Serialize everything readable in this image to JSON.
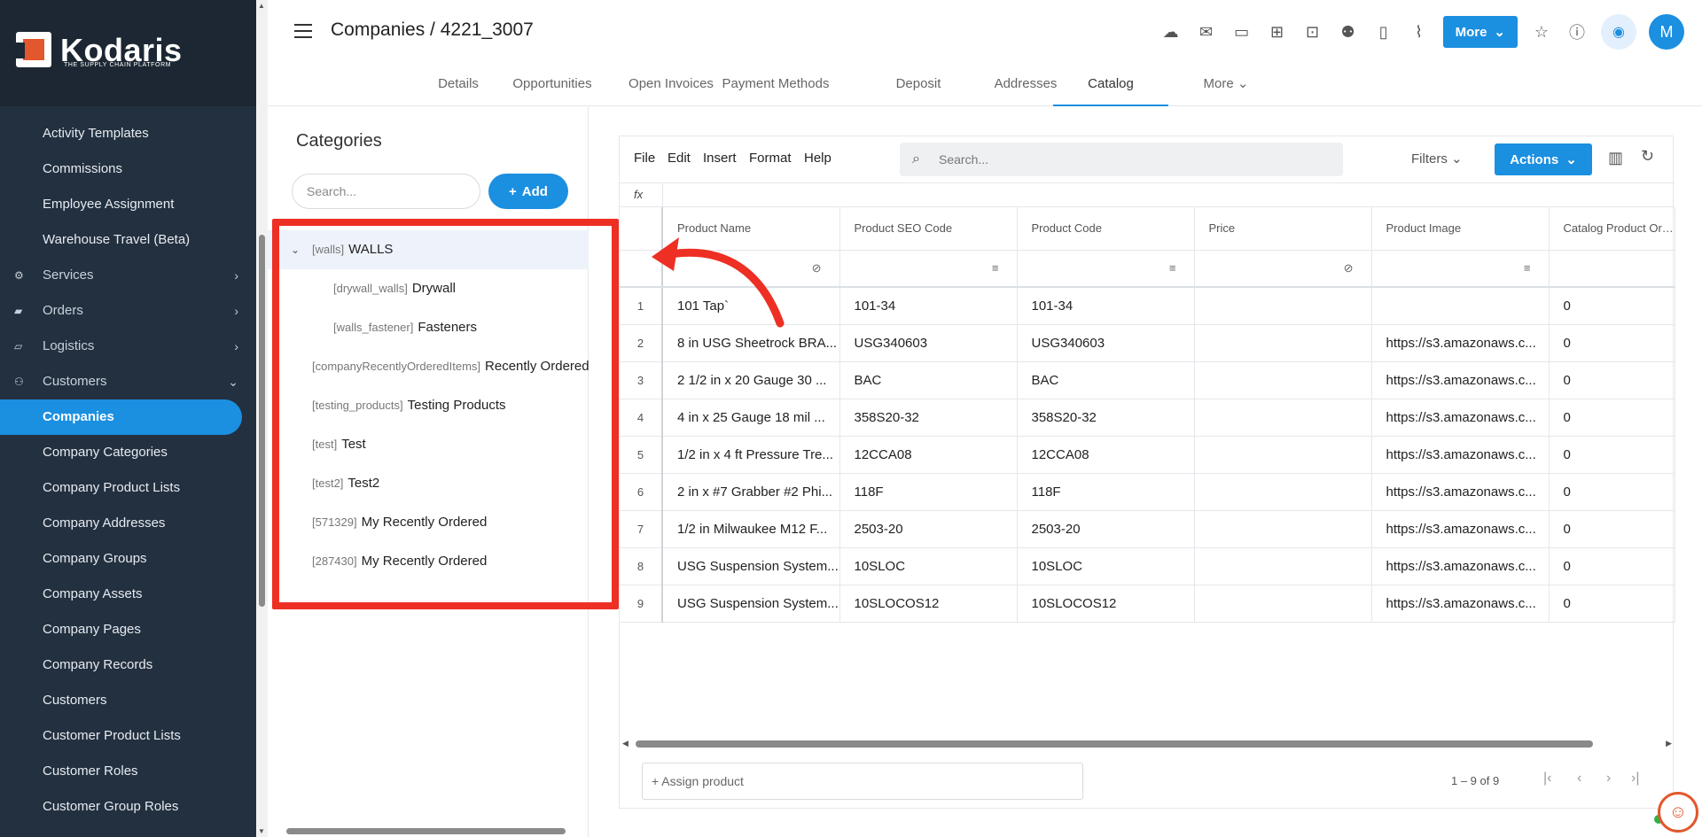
{
  "brand": {
    "name": "Kodaris",
    "tagline": "THE SUPPLY CHAIN PLATFORM",
    "accent": "#1b8fe0",
    "logo_orange": "#e2572b",
    "highlight_red": "#ee2f24"
  },
  "sidebar": {
    "items": [
      {
        "label": "Activity Templates",
        "icon": "",
        "type": "child"
      },
      {
        "label": "Commissions",
        "icon": "",
        "type": "child"
      },
      {
        "label": "Employee Assignment",
        "icon": "",
        "type": "child"
      },
      {
        "label": "Warehouse Travel (Beta)",
        "icon": "",
        "type": "child"
      },
      {
        "label": "Services",
        "icon": "services-icon",
        "type": "group",
        "chevron": "›"
      },
      {
        "label": "Orders",
        "icon": "truck-icon",
        "type": "group",
        "chevron": "›"
      },
      {
        "label": "Logistics",
        "icon": "van-icon",
        "type": "group",
        "chevron": "›"
      },
      {
        "label": "Customers",
        "icon": "people-icon",
        "type": "group",
        "chevron": "⌄"
      },
      {
        "label": "Companies",
        "icon": "",
        "type": "active"
      },
      {
        "label": "Company Categories",
        "icon": "",
        "type": "child"
      },
      {
        "label": "Company Product Lists",
        "icon": "",
        "type": "child"
      },
      {
        "label": "Company Addresses",
        "icon": "",
        "type": "child"
      },
      {
        "label": "Company Groups",
        "icon": "",
        "type": "child"
      },
      {
        "label": "Company Assets",
        "icon": "",
        "type": "child"
      },
      {
        "label": "Company Pages",
        "icon": "",
        "type": "child"
      },
      {
        "label": "Company Records",
        "icon": "",
        "type": "child"
      },
      {
        "label": "Customers",
        "icon": "",
        "type": "child"
      },
      {
        "label": "Customer Product Lists",
        "icon": "",
        "type": "child"
      },
      {
        "label": "Customer Roles",
        "icon": "",
        "type": "child"
      },
      {
        "label": "Customer Group Roles",
        "icon": "",
        "type": "child"
      }
    ]
  },
  "header": {
    "title": "Companies / 4221_3007",
    "more_label": "More",
    "avatar_initial": "M",
    "tabs": [
      {
        "label": "Details",
        "active": false
      },
      {
        "label": "Opportunities",
        "active": false
      },
      {
        "label": "Open Invoices",
        "active": false
      },
      {
        "label": "Payment Methods",
        "active": false
      },
      {
        "label": "Deposit",
        "active": false
      },
      {
        "label": "Addresses",
        "active": false
      },
      {
        "label": "Catalog",
        "active": true
      },
      {
        "label": "More",
        "active": false
      }
    ]
  },
  "categories": {
    "title": "Categories",
    "search_placeholder": "Search...",
    "add_label": "Add",
    "tree": [
      {
        "code": "[walls]",
        "name": "WALLS",
        "level": 0,
        "expanded": true,
        "selected": true
      },
      {
        "code": "[drywall_walls]",
        "name": "Drywall",
        "level": 1
      },
      {
        "code": "[walls_fastener]",
        "name": "Fasteners",
        "level": 1
      },
      {
        "code": "[companyRecentlyOrderedItems]",
        "name": "Recently Ordered",
        "level": 0
      },
      {
        "code": "[testing_products]",
        "name": "Testing Products",
        "level": 0
      },
      {
        "code": "[test]",
        "name": "Test",
        "level": 0
      },
      {
        "code": "[test2]",
        "name": "Test2",
        "level": 0
      },
      {
        "code": "[571329]",
        "name": "My Recently Ordered",
        "level": 0
      },
      {
        "code": "[287430]",
        "name": "My Recently Ordered",
        "level": 0
      }
    ]
  },
  "grid": {
    "menu": [
      "File",
      "Edit",
      "Insert",
      "Format",
      "Help"
    ],
    "search_placeholder": "Search...",
    "filters_label": "Filters",
    "actions_label": "Actions",
    "fx_label": "fx",
    "columns": [
      "Product Name",
      "Product SEO Code",
      "Product Code",
      "Price",
      "Product Image",
      "Catalog Product Order"
    ],
    "rows": [
      [
        "1",
        "101 Tap`",
        "101-34",
        "101-34",
        "",
        "",
        "0"
      ],
      [
        "2",
        "8 in USG Sheetrock BRA...",
        "USG340603",
        "USG340603",
        "",
        "https://s3.amazonaws.c...",
        "0"
      ],
      [
        "3",
        "2 1/2 in x 20 Gauge 30 ...",
        "BAC",
        "BAC",
        "",
        "https://s3.amazonaws.c...",
        "0"
      ],
      [
        "4",
        "4 in x 25 Gauge 18 mil ...",
        "358S20-32",
        "358S20-32",
        "",
        "https://s3.amazonaws.c...",
        "0"
      ],
      [
        "5",
        "1/2 in x 4 ft Pressure Tre...",
        "12CCA08",
        "12CCA08",
        "",
        "https://s3.amazonaws.c...",
        "0"
      ],
      [
        "6",
        "2 in x #7 Grabber #2 Phi...",
        "118F",
        "118F",
        "",
        "https://s3.amazonaws.c...",
        "0"
      ],
      [
        "7",
        "1/2 in Milwaukee M12 F...",
        "2503-20",
        "2503-20",
        "",
        "https://s3.amazonaws.c...",
        "0"
      ],
      [
        "8",
        "USG Suspension System...",
        "10SLOC",
        "10SLOC",
        "",
        "https://s3.amazonaws.c...",
        "0"
      ],
      [
        "9",
        "USG Suspension System...",
        "10SLOCOS12",
        "10SLOCOS12",
        "",
        "https://s3.amazonaws.c...",
        "0"
      ]
    ],
    "assign_label": "+ Assign product",
    "pager_text": "1 – 9 of 9"
  }
}
